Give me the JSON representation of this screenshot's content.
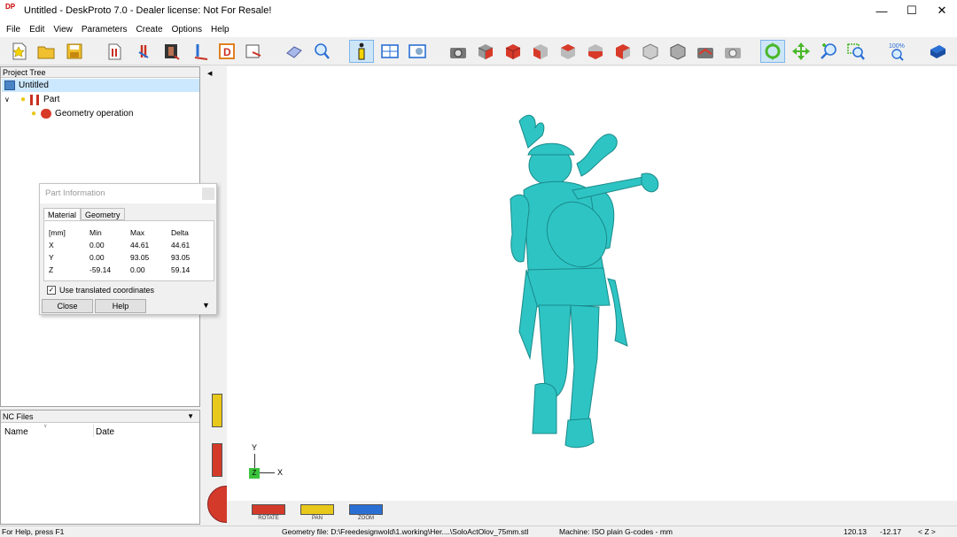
{
  "window": {
    "title": "Untitled - DeskProto 7.0 - Dealer license: Not For Resale!",
    "logo": "DP",
    "controls": [
      "minimize-icon",
      "maximize-icon",
      "close-icon"
    ]
  },
  "menu": [
    "File",
    "Edit",
    "View",
    "Parameters",
    "Create",
    "Options",
    "Help"
  ],
  "toolbar": {
    "zoom_label": "100%",
    "icons": [
      "new-icon",
      "open-icon",
      "save-icon",
      "part-icon",
      "add-part-icon",
      "image-icon",
      "vector-icon",
      "drawing-icon",
      "export-icon",
      "eraser-icon",
      "magnify-icon",
      "info-icon",
      "layout-icon",
      "view-icon",
      "camera-icon",
      "view-cube-icon",
      "view-cube-icon",
      "view-cube-icon",
      "view-cube-icon",
      "view-cube-icon",
      "view-cube-icon",
      "view-cube-icon",
      "view-cube-icon",
      "camera-arrow-icon",
      "camera-icon",
      "rotate-tool-icon",
      "pan-tool-icon",
      "zoom-tool-icon",
      "zoom-window-icon",
      "zoom-100-icon",
      "book-icon"
    ]
  },
  "project_tree": {
    "header": "Project Tree",
    "items": [
      {
        "label": "Untitled",
        "level": 0,
        "selected": true
      },
      {
        "label": "Part",
        "level": 1,
        "selected": false
      },
      {
        "label": "Geometry operation",
        "level": 2,
        "selected": false
      }
    ]
  },
  "nc_files": {
    "header": "NC Files",
    "columns": [
      "Name",
      "Date"
    ]
  },
  "part_info": {
    "title": "Part Information",
    "tabs": [
      "Material",
      "Geometry"
    ],
    "active_tab": "Material",
    "table": {
      "headers": [
        "[mm]",
        "Min",
        "Max",
        "Delta"
      ],
      "rows": [
        [
          "X",
          "0.00",
          "44.61",
          "44.61"
        ],
        [
          "Y",
          "0.00",
          "93.05",
          "93.05"
        ],
        [
          "Z",
          "-59.14",
          "0.00",
          "59.14"
        ]
      ]
    },
    "checkbox_label": "Use translated coordinates",
    "checkbox_checked": true,
    "close_label": "Close",
    "help_label": "Help"
  },
  "axes": {
    "y": "Y",
    "x": "X",
    "z": "Z"
  },
  "view_controls": [
    "ROTATE",
    "PAN",
    "ZOOM"
  ],
  "colors": {
    "model": "#2ec4c4",
    "rotate": "#d43a2a",
    "pan": "#e8c81a",
    "zoom": "#2a6fd4",
    "selection": "#cce8ff"
  },
  "status": {
    "help": "For Help, press F1",
    "geometry_file": "Geometry file: D:\\Freedesignwold\\1.working\\Her....\\SoloActOlov_75mm.stl",
    "machine": "Machine: ISO plain G-codes - mm",
    "coord_x": "120.13",
    "coord_y": "-12.17",
    "axis": "< Z >"
  }
}
